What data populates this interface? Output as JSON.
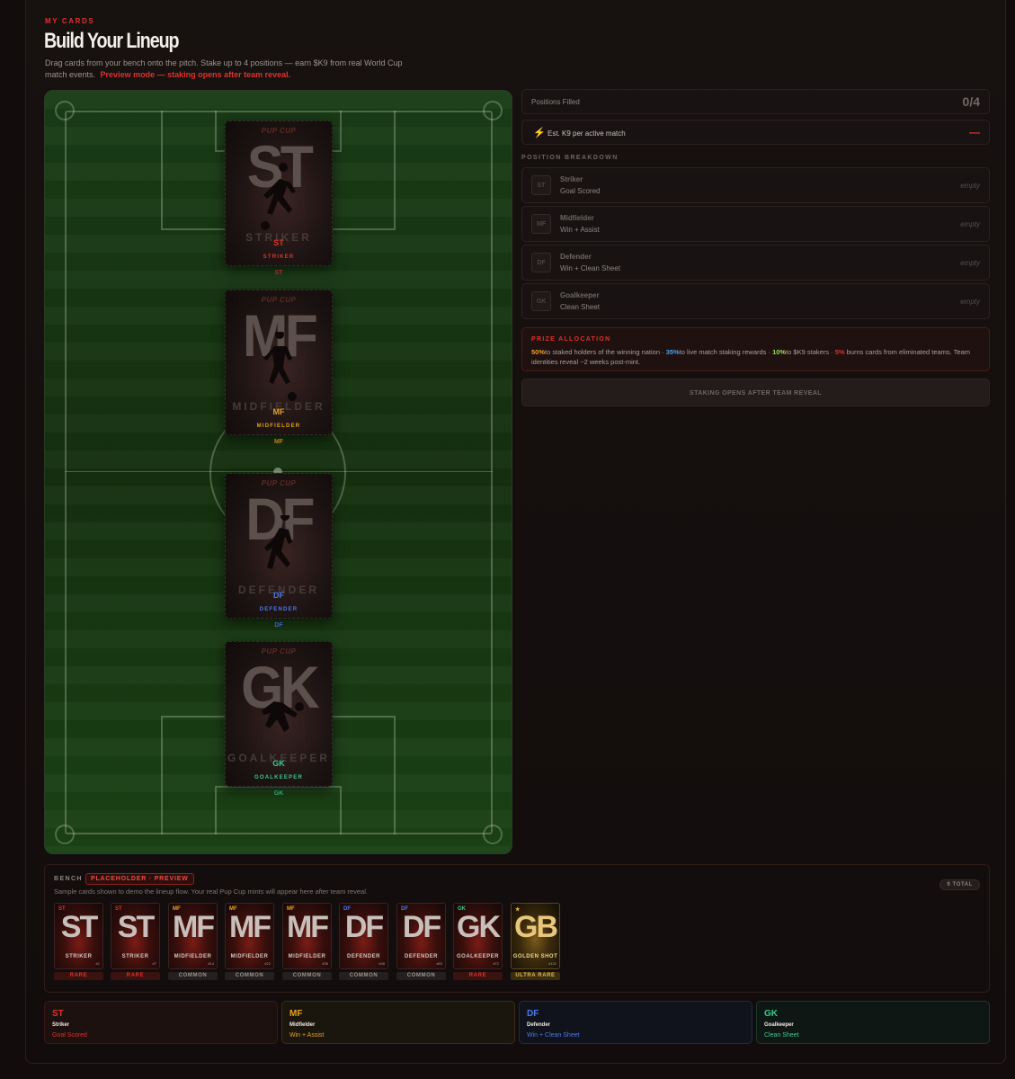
{
  "header": {
    "eyebrow": "MY CARDS",
    "title": "Build Your Lineup",
    "subtitle": "Drag cards from your bench onto the pitch. Stake up to 4 positions — earn $K9 from real World Cup match events.",
    "preview_note": "Preview mode — staking opens after team reveal."
  },
  "pitch": {
    "slots": [
      {
        "code": "ST",
        "brand": "PUP CUP",
        "role": "STRIKER",
        "tag": "ST",
        "color": "#e0312a"
      },
      {
        "code": "MF",
        "brand": "PUP CUP",
        "role": "MIDFIELDER",
        "tag": "MF",
        "color": "#e8a020"
      },
      {
        "code": "DF",
        "brand": "PUP CUP",
        "role": "DEFENDER",
        "tag": "DF",
        "color": "#4a78e8"
      },
      {
        "code": "GK",
        "brand": "PUP CUP",
        "role": "GOALKEEPER",
        "tag": "GK",
        "color": "#3ac98a"
      }
    ]
  },
  "summary": {
    "positions_filled_label": "Positions Filled",
    "positions_filled_value": "0/4",
    "est_label": "Est. K9 per active match",
    "est_value": "—",
    "breakdown_heading": "POSITION BREAKDOWN",
    "breakdown": [
      {
        "code": "ST",
        "name": "Striker",
        "condition": "Goal Scored",
        "status": "empty"
      },
      {
        "code": "MF",
        "name": "Midfielder",
        "condition": "Win + Assist",
        "status": "empty"
      },
      {
        "code": "DF",
        "name": "Defender",
        "condition": "Win + Clean Sheet",
        "status": "empty"
      },
      {
        "code": "GK",
        "name": "Goalkeeper",
        "condition": "Clean Sheet",
        "status": "empty"
      }
    ]
  },
  "prize": {
    "heading": "PRIZE ALLOCATION",
    "p1": "50%",
    "t1": "to staked holders of the winning nation · ",
    "p2": "35%",
    "t2": "to live match staking rewards · ",
    "p3": "10%",
    "t3": "to $K9 stakers · ",
    "p4": "5%",
    "t4": " burns cards from eliminated teams. Team identities reveal ~2 weeks post-mint."
  },
  "cta_label": "STAKING OPENS AFTER TEAM REVEAL",
  "bench": {
    "label": "BENCH",
    "badge": "PLACEHOLDER · PREVIEW",
    "note": "Sample cards shown to demo the lineup flow. Your real Pup Cup mints will appear here after team reveal.",
    "total": "9 TOTAL",
    "cards": [
      {
        "code": "ST",
        "role": "STRIKER",
        "num": "#1",
        "rarity": "RARE",
        "color": "#e0312a"
      },
      {
        "code": "ST",
        "role": "STRIKER",
        "num": "#7",
        "rarity": "RARE",
        "color": "#e0312a"
      },
      {
        "code": "MF",
        "role": "MIDFIELDER",
        "num": "#14",
        "rarity": "COMMON",
        "color": "#e8a020"
      },
      {
        "code": "MF",
        "role": "MIDFIELDER",
        "num": "#22",
        "rarity": "COMMON",
        "color": "#e8a020"
      },
      {
        "code": "MF",
        "role": "MIDFIELDER",
        "num": "#38",
        "rarity": "COMMON",
        "color": "#e8a020"
      },
      {
        "code": "DF",
        "role": "DEFENDER",
        "num": "#48",
        "rarity": "COMMON",
        "color": "#4a78e8"
      },
      {
        "code": "DF",
        "role": "DEFENDER",
        "num": "#63",
        "rarity": "COMMON",
        "color": "#4a78e8"
      },
      {
        "code": "GK",
        "role": "GOALKEEPER",
        "num": "#72",
        "rarity": "RARE",
        "color": "#3ac98a"
      },
      {
        "code": "GB",
        "role": "GOLDEN SHOT",
        "num": "#132",
        "rarity": "ULTRA RARE",
        "color": "#e8b84a"
      }
    ]
  },
  "legend": [
    {
      "code": "ST",
      "name": "Striker",
      "desc": "Goal Scored",
      "color": "#e0312a"
    },
    {
      "code": "MF",
      "name": "Midfielder",
      "desc": "Win + Assist",
      "color": "#e8a020"
    },
    {
      "code": "DF",
      "name": "Defender",
      "desc": "Win + Clean Sheet",
      "color": "#4a78e8"
    },
    {
      "code": "GK",
      "name": "Goalkeeper",
      "desc": "Clean Sheet",
      "color": "#3ac98a"
    }
  ]
}
